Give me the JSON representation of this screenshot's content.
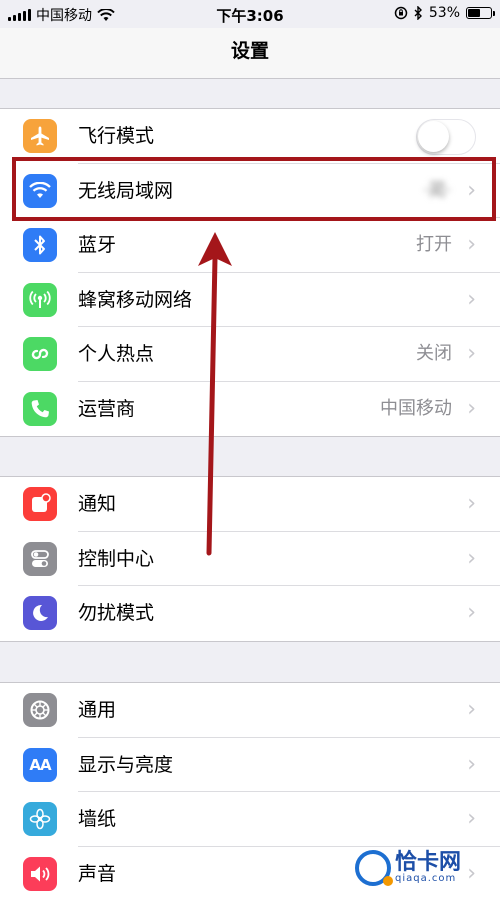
{
  "status_bar": {
    "carrier": "中国移动",
    "time": "下午3:06",
    "battery": "53%",
    "battery_level": 0.53,
    "icons": [
      "signal-icon",
      "wifi-icon",
      "rotation-lock-icon",
      "bluetooth-icon",
      "battery-icon"
    ]
  },
  "nav": {
    "title": "设置"
  },
  "groups": [
    [
      {
        "label": "飞行模式",
        "icon": "airplane-icon",
        "color": "#f7a33b",
        "toggle": "off"
      },
      {
        "label": "无线局域网",
        "icon": "wifi-icon",
        "color": "#2f7cf6",
        "value": "·蔺·",
        "chevron": "›"
      },
      {
        "label": "蓝牙",
        "icon": "bluetooth-icon",
        "color": "#2f7cf6",
        "value": "打开",
        "chevron": "›"
      },
      {
        "label": "蜂窝移动网络",
        "icon": "cellular-icon",
        "color": "#4cd964",
        "chevron": "›"
      },
      {
        "label": "个人热点",
        "icon": "hotspot-icon",
        "color": "#4cd964",
        "value": "关闭",
        "chevron": "›"
      },
      {
        "label": "运营商",
        "icon": "phone-icon",
        "color": "#4cd964",
        "value": "中国移动",
        "chevron": "›"
      }
    ],
    [
      {
        "label": "通知",
        "icon": "notification-icon",
        "color": "#fc3d39",
        "chevron": "›"
      },
      {
        "label": "控制中心",
        "icon": "control-center-icon",
        "color": "#8e8e93",
        "chevron": "›"
      },
      {
        "label": "勿扰模式",
        "icon": "moon-icon",
        "color": "#5856d6",
        "chevron": "›"
      }
    ],
    [
      {
        "label": "通用",
        "icon": "gear-icon",
        "color": "#8e8e93",
        "chevron": "›"
      },
      {
        "label": "显示与亮度",
        "icon": "display-icon",
        "color": "#2f7cf6",
        "icon_text": "AA",
        "chevron": "›"
      },
      {
        "label": "墙纸",
        "icon": "wallpaper-icon",
        "color": "#36aadc",
        "chevron": "›"
      },
      {
        "label": "声音",
        "icon": "sound-icon",
        "color": "#fc3d59",
        "chevron": "›"
      }
    ]
  ],
  "annotation_color": "#a4161a",
  "watermark": {
    "title": "恰卡网",
    "subtitle": "qiaqa.com"
  }
}
